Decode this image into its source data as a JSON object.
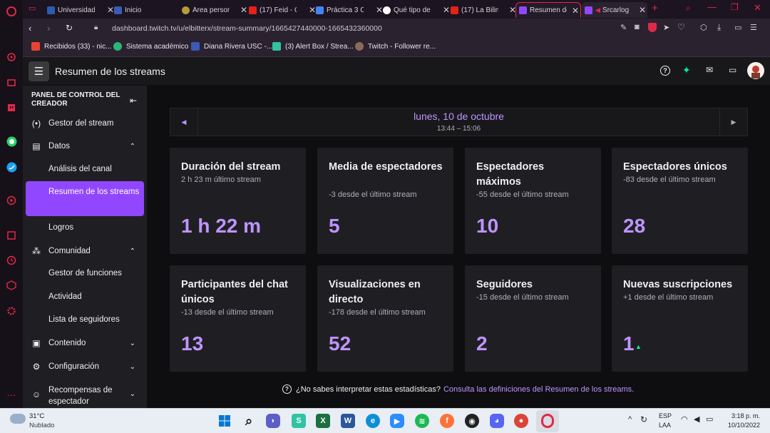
{
  "browser": {
    "tabs": [
      {
        "title": "Universidad"
      },
      {
        "title": "Inicio"
      },
      {
        "title": "Área person"
      },
      {
        "title": "(17) Feid - C"
      },
      {
        "title": "Práctica 3 C"
      },
      {
        "title": "Qué tipo de"
      },
      {
        "title": "(17) La Bilin"
      },
      {
        "title": "Resumen de"
      },
      {
        "title": "Srcarlog"
      }
    ],
    "url": "dashboard.twitch.tv/u/elbitterx/stream-summary/1665427440000-1665432360000",
    "bookmarks": [
      {
        "label": "Recibidos (33) - nic..."
      },
      {
        "label": "Sistema académico"
      },
      {
        "label": "Diana Rivera USC -..."
      },
      {
        "label": "(3) Alert Box / Strea..."
      },
      {
        "label": "Twitch - Follower re..."
      }
    ]
  },
  "header": {
    "title": "Resumen de los streams"
  },
  "sidebar": {
    "heading": "PANEL DE CONTROL DEL CREADOR",
    "items": [
      {
        "label": "Gestor del stream",
        "icon": "broadcast-icon"
      },
      {
        "label": "Datos",
        "icon": "chart-icon"
      },
      {
        "label": "Análisis del canal"
      },
      {
        "label": "Resumen de los streams"
      },
      {
        "label": "Logros"
      },
      {
        "label": "Comunidad",
        "icon": "community-icon"
      },
      {
        "label": "Gestor de funciones"
      },
      {
        "label": "Actividad"
      },
      {
        "label": "Lista de seguidores"
      },
      {
        "label": "Contenido",
        "icon": "content-icon"
      },
      {
        "label": "Configuración",
        "icon": "gear-icon"
      },
      {
        "label": "Recompensas de espectador",
        "icon": "reward-icon"
      }
    ]
  },
  "date_nav": {
    "date": "lunes, 10 de octubre",
    "time_range": "13:44 – 15:06"
  },
  "stats": [
    {
      "title": "Duración del stream",
      "delta": "2 h 23 m último stream",
      "value": "1 h 22 m"
    },
    {
      "title": "Media de espectadores",
      "delta": "-3 desde el último stream",
      "value": "5"
    },
    {
      "title": "Espectadores máximos",
      "delta": "-55 desde el último stream",
      "value": "10"
    },
    {
      "title": "Espectadores únicos",
      "delta": "-83 desde el último stream",
      "value": "28"
    },
    {
      "title": "Participantes del chat únicos",
      "delta": "-13 desde el último stream",
      "value": "13"
    },
    {
      "title": "Visualizaciones en directo",
      "delta": "-178 desde el último stream",
      "value": "52"
    },
    {
      "title": "Seguidores",
      "delta": "-15 desde el último stream",
      "value": "2"
    },
    {
      "title": "Nuevas suscripciones",
      "delta": "+1 desde el último stream",
      "value": "1"
    }
  ],
  "help": {
    "question": "¿No sabes interpretar estas estadísticas?",
    "link": "Consulta las definiciones del Resumen de los streams."
  },
  "taskbar": {
    "weather_temp": "31°C",
    "weather_desc": "Nublado",
    "lang": "ESP",
    "lang2": "LAA",
    "time": "3:18 p. m.",
    "date": "10/10/2022"
  },
  "colors": {
    "accent": "#9147ff",
    "value": "#bf94ff",
    "link": "#bf94ff",
    "positive": "#00f593"
  }
}
